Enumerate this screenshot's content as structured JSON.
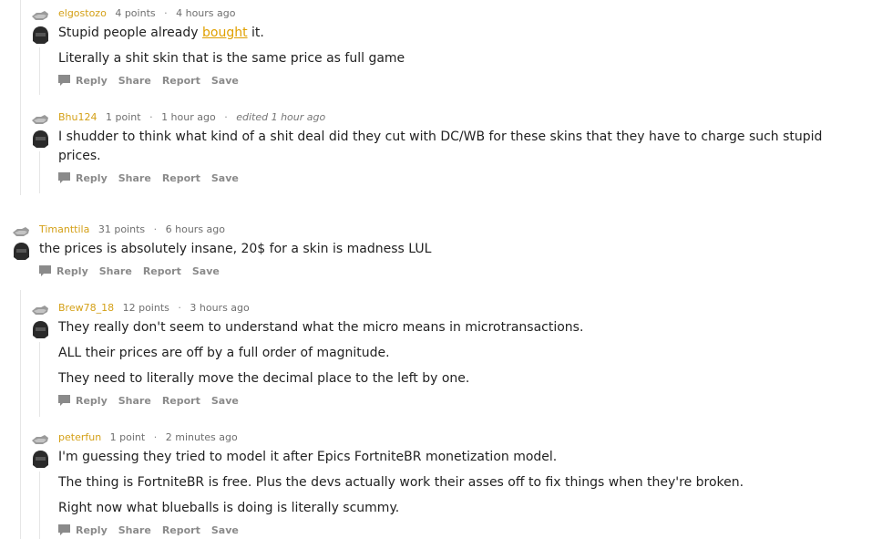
{
  "colors": {
    "author": "#d4a017",
    "link": "#e0a000",
    "meta": "#6f6f6f",
    "actions": "#8a8a8a",
    "thread_line": "#e6e6e6"
  },
  "icons": {
    "upvote": "upvote-arrow-icon",
    "avatar": "helmet-avatar-icon",
    "reply": "speech-bubble-icon"
  },
  "comments": [
    {
      "author": "elgostozo",
      "points": "4 points",
      "time": "4 hours ago",
      "edited": "",
      "lines": [
        "Stupid people already ",
        "bought",
        " it.",
        "Literally a shit skin that is the same price as full game"
      ],
      "actions": [
        "Reply",
        "Share",
        "Report",
        "Save"
      ]
    },
    {
      "author": "Bhu124",
      "points": "1 point",
      "time": "1 hour ago",
      "edited": "edited 1 hour ago",
      "lines": [
        "I shudder to think what kind of a shit deal did they cut with DC/WB for these skins that they have to charge such stupid",
        "prices."
      ],
      "actions": [
        "Reply",
        "Share",
        "Report",
        "Save"
      ]
    },
    {
      "author": "Timanttila",
      "points": "31 points",
      "time": "6 hours ago",
      "edited": "",
      "lines": [
        "the prices is absolutely insane, 20$ for a skin is madness LUL"
      ],
      "actions": [
        "Reply",
        "Share",
        "Report",
        "Save"
      ]
    },
    {
      "author": "Brew78_18",
      "points": "12 points",
      "time": "3 hours ago",
      "edited": "",
      "lines": [
        "They really don't seem to understand what the micro means in microtransactions.",
        "ALL their prices are off by a full order of magnitude.",
        "They need to literally move the decimal place to the left by one."
      ],
      "actions": [
        "Reply",
        "Share",
        "Report",
        "Save"
      ]
    },
    {
      "author": "peterfun",
      "points": "1 point",
      "time": "2 minutes ago",
      "edited": "",
      "lines": [
        "I'm guessing they tried to model it after Epics FortniteBR monetization model.",
        "The thing is FortniteBR is free. Plus the devs actually work their asses off to fix things when they're broken.",
        "Right now what blueballs is doing is literally scummy."
      ],
      "actions": [
        "Reply",
        "Share",
        "Report",
        "Save"
      ]
    }
  ]
}
